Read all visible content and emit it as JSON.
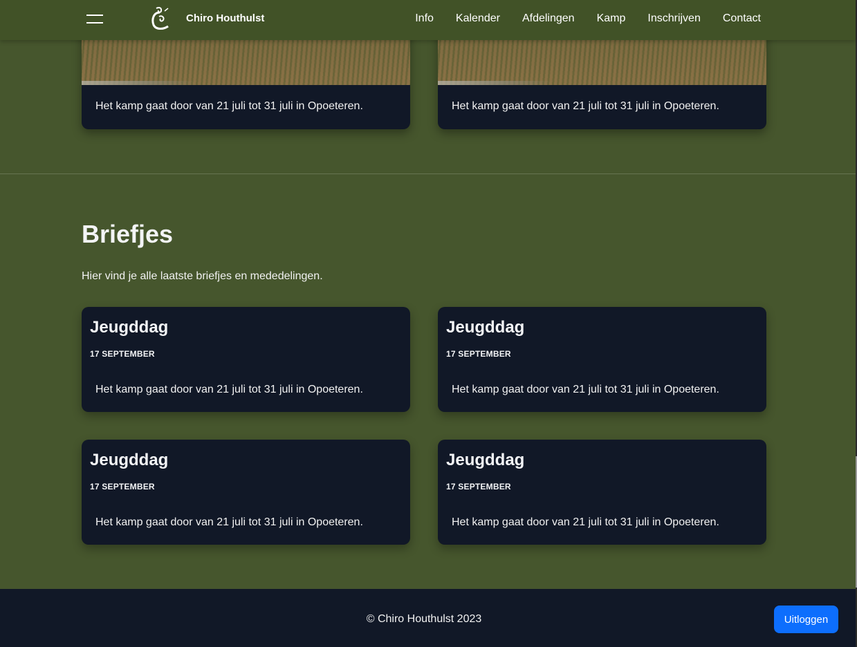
{
  "nav": {
    "brand": "Chiro Houthulst",
    "links": [
      "Info",
      "Kalender",
      "Afdelingen",
      "Kamp",
      "Inschrijven",
      "Contact"
    ]
  },
  "kamp_cards": [
    {
      "text": "Het kamp gaat door van 21 juli tot 31 juli in Opoeteren."
    },
    {
      "text": "Het kamp gaat door van 21 juli tot 31 juli in Opoeteren."
    }
  ],
  "briefjes": {
    "title": "Briefjes",
    "intro": "Hier vind je alle laatste briefjes en mededelingen.",
    "cards": [
      {
        "title": "Jeugddag",
        "date": "17 SEPTEMBER",
        "text": "Het kamp gaat door van 21 juli tot 31 juli in Opoeteren."
      },
      {
        "title": "Jeugddag",
        "date": "17 SEPTEMBER",
        "text": "Het kamp gaat door van 21 juli tot 31 juli in Opoeteren."
      },
      {
        "title": "Jeugddag",
        "date": "17 SEPTEMBER",
        "text": "Het kamp gaat door van 21 juli tot 31 juli in Opoeteren."
      },
      {
        "title": "Jeugddag",
        "date": "17 SEPTEMBER",
        "text": "Het kamp gaat door van 21 juli tot 31 juli in Opoeteren."
      }
    ]
  },
  "footer": {
    "copyright": "© Chiro Houthulst 2023",
    "logout_label": "Uitloggen"
  },
  "colors": {
    "page_bg": "#46562d",
    "nav_bg": "#415227",
    "card_bg": "#111827",
    "button": "#0d6efd"
  }
}
